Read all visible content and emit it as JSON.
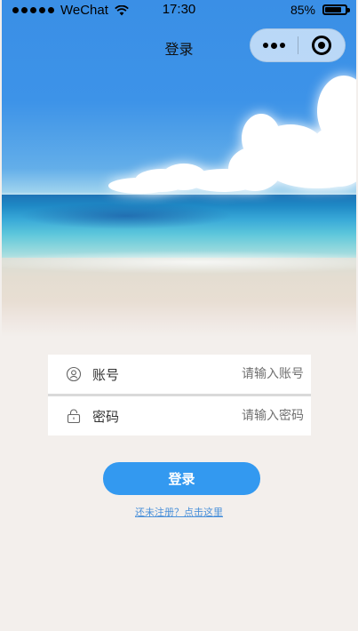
{
  "status_bar": {
    "carrier": "WeChat",
    "time": "17:30",
    "battery": "85%",
    "battery_level": 0.85
  },
  "nav": {
    "title": "登录"
  },
  "form": {
    "account_label": "账号",
    "account_placeholder": "请输入账号",
    "account_icon": "user-icon",
    "password_label": "密码",
    "password_placeholder": "请输入密码",
    "password_icon": "lock-icon"
  },
  "actions": {
    "login_label": "登录",
    "register_link": "还未注册？点击这里"
  },
  "colors": {
    "primary": "#3399f0",
    "background": "#f3efec",
    "link": "#4a90d9"
  }
}
